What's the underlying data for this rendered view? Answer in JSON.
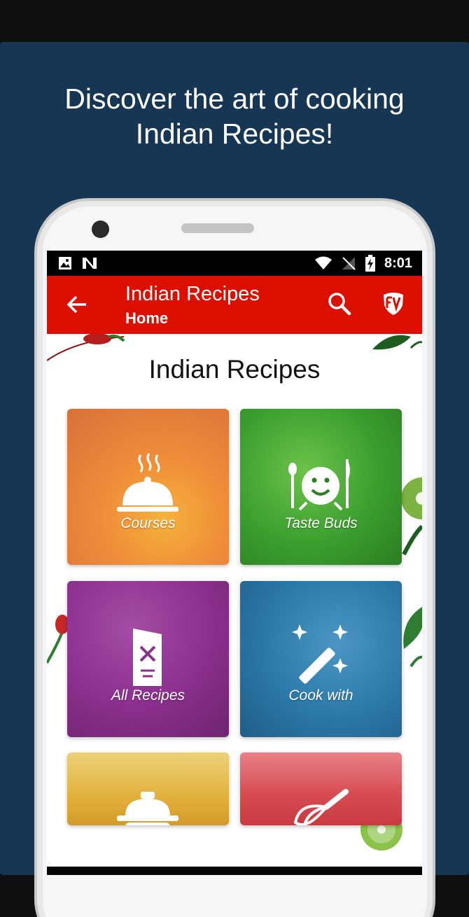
{
  "promo": {
    "headline_line1": "Discover the art of cooking",
    "headline_line2": "Indian Recipes!"
  },
  "status_bar": {
    "time": "8:01",
    "icons": [
      "image-icon",
      "n-logo-icon",
      "wifi-icon",
      "no-signal-icon",
      "battery-charging-icon"
    ]
  },
  "toolbar": {
    "title": "Indian Recipes",
    "subtitle": "Home",
    "back_icon": "arrow-back-icon",
    "search_icon": "search-icon",
    "brand_icon": "shield-logo-icon",
    "color": "#dc0e00"
  },
  "main": {
    "heading": "Indian Recipes",
    "tiles": [
      {
        "label": "Courses",
        "icon": "cloche-icon",
        "tint": "#ef8a3a"
      },
      {
        "label": "Taste Buds",
        "icon": "smiley-cutlery-icon",
        "tint": "#2f9b2a"
      },
      {
        "label": "All Recipes",
        "icon": "menu-card-icon",
        "tint": "#8a2f8c"
      },
      {
        "label": "Cook with",
        "icon": "magic-wand-icon",
        "tint": "#2b78a8"
      },
      {
        "label": "",
        "icon": "pressure-cooker-icon",
        "tint": "#e2b23c"
      },
      {
        "label": "",
        "icon": "whisk-icon",
        "tint": "#d74a4f"
      }
    ]
  },
  "colors": {
    "promo_background": "#173654",
    "toolbar": "#dc0e00"
  }
}
